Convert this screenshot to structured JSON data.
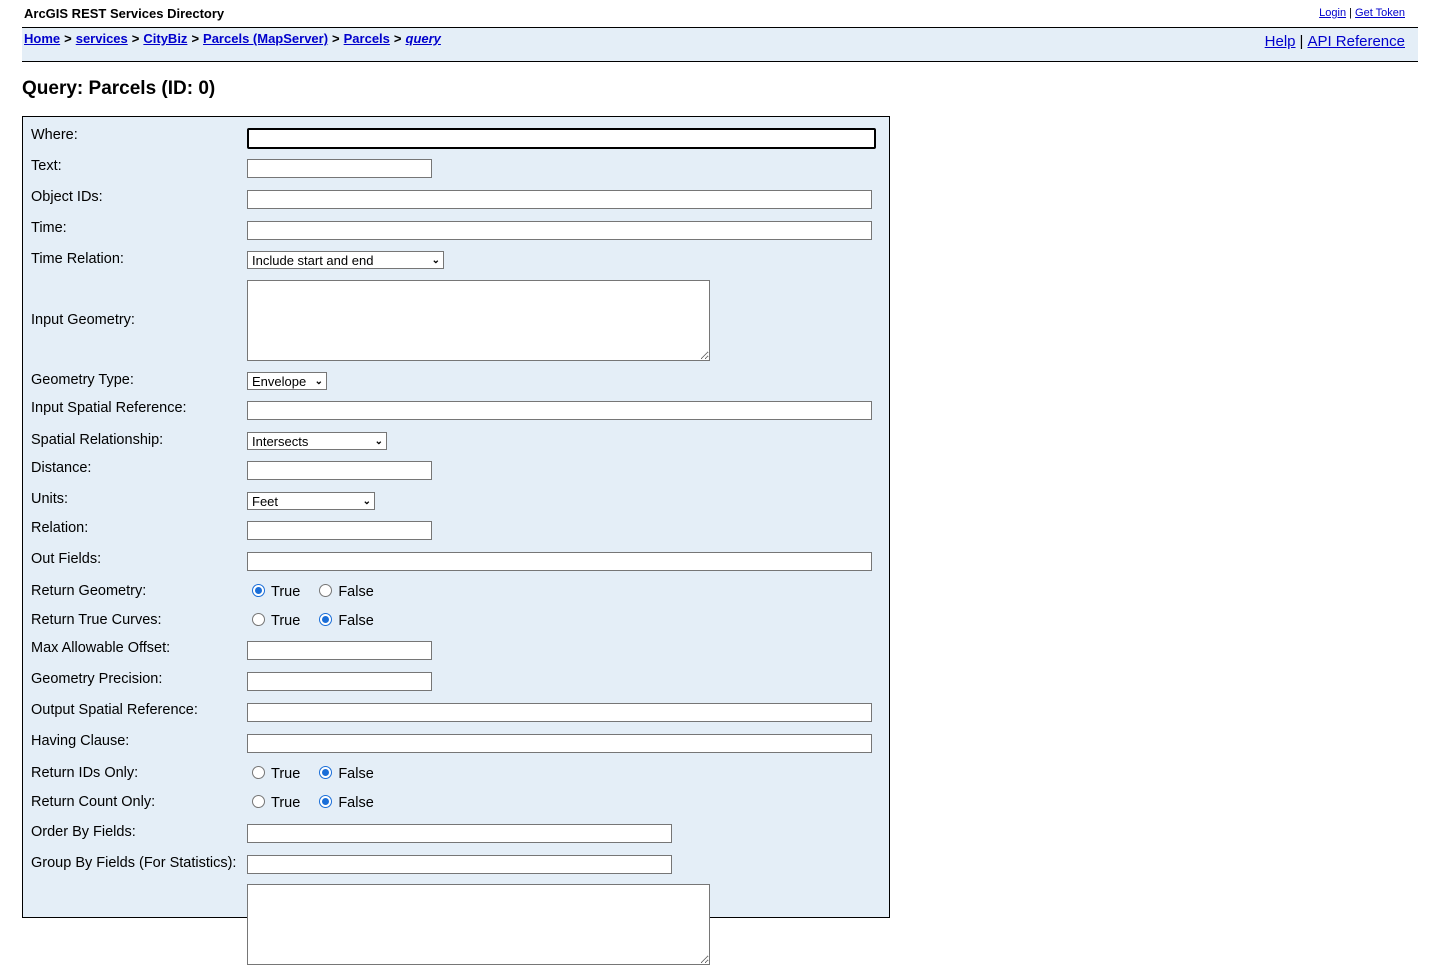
{
  "header": {
    "title": "ArcGIS REST Services Directory",
    "login": "Login",
    "separator": "|",
    "get_token": "Get Token"
  },
  "nav": {
    "crumbs": [
      "Home",
      "services",
      "CityBiz",
      "Parcels (MapServer)",
      "Parcels"
    ],
    "current": "query",
    "crumb_sep": ">",
    "help": "Help",
    "api_reference": "API Reference",
    "help_sep": "|"
  },
  "page": {
    "title": "Query: Parcels (ID: 0)"
  },
  "form": {
    "where": "Where:",
    "text": "Text:",
    "object_ids": "Object IDs:",
    "time": "Time:",
    "time_relation": "Time Relation:",
    "time_relation_value": "Include start and end",
    "input_geometry": "Input Geometry:",
    "geometry_type": "Geometry Type:",
    "geometry_type_value": "Envelope",
    "input_spatial_reference": "Input Spatial Reference:",
    "spatial_relationship": "Spatial Relationship:",
    "spatial_relationship_value": "Intersects",
    "distance": "Distance:",
    "units": "Units:",
    "units_value": "Feet",
    "relation": "Relation:",
    "out_fields": "Out Fields:",
    "return_geometry": "Return Geometry:",
    "return_true_curves": "Return True Curves:",
    "max_allowable_offset": "Max Allowable Offset:",
    "geometry_precision": "Geometry Precision:",
    "output_spatial_reference": "Output Spatial Reference:",
    "having_clause": "Having Clause:",
    "return_ids_only": "Return IDs Only:",
    "return_count_only": "Return Count Only:",
    "order_by_fields": "Order By Fields:",
    "group_by_fields": "Group By Fields (For Statistics):",
    "true_label": "True",
    "false_label": "False"
  }
}
